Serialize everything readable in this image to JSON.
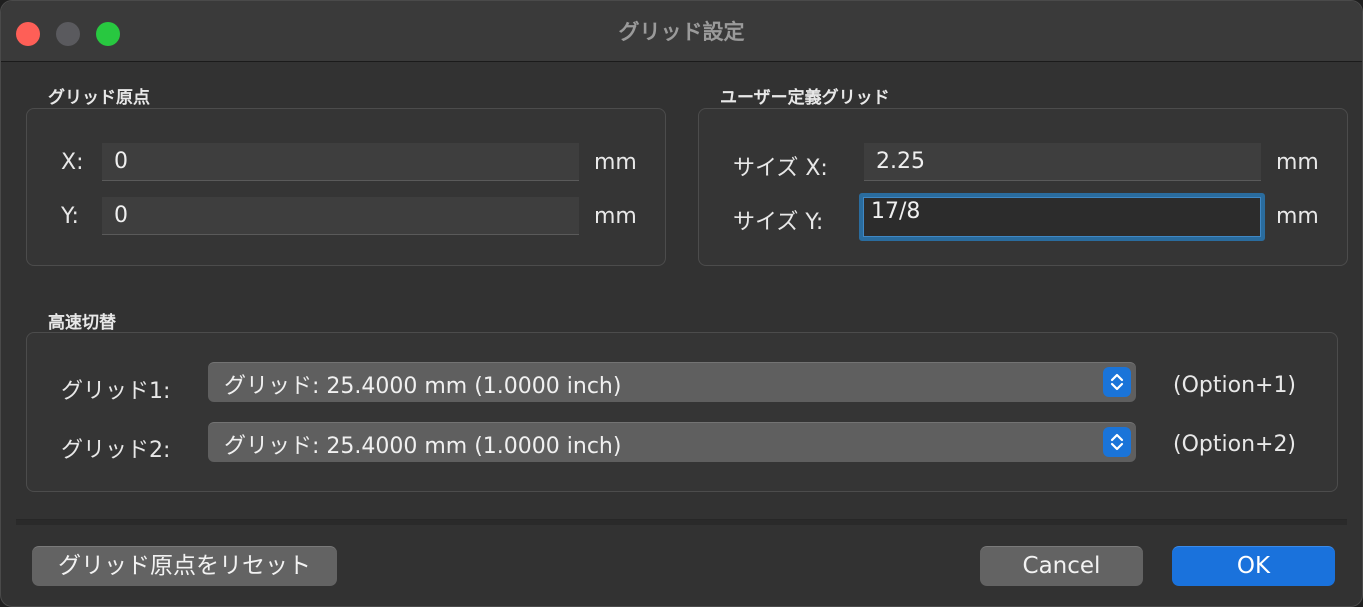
{
  "window": {
    "title": "グリッド設定"
  },
  "origin": {
    "label": "グリッド原点",
    "x_label": "X:",
    "x_value": "0",
    "x_unit": "mm",
    "y_label": "Y:",
    "y_value": "0",
    "y_unit": "mm"
  },
  "user_grid": {
    "label": "ユーザー定義グリッド",
    "x_label": "サイズ X:",
    "x_value": "2.25",
    "x_unit": "mm",
    "y_label": "サイズ Y:",
    "y_value": "17/8",
    "y_unit": "mm"
  },
  "fast_switch": {
    "label": "高速切替",
    "grid1_label": "グリッド1:",
    "grid1_value": "グリッド: 25.4000 mm (1.0000 inch)",
    "grid1_shortcut": "(Option+1)",
    "grid2_label": "グリッド2:",
    "grid2_value": "グリッド: 25.4000 mm (1.0000 inch)",
    "grid2_shortcut": "(Option+2)"
  },
  "buttons": {
    "reset": "グリッド原点をリセット",
    "cancel": "Cancel",
    "ok": "OK"
  },
  "colors": {
    "accent": "#1a72dc",
    "focus_ring": "#2a6c9e",
    "close": "#fe5f57",
    "zoom": "#28c840"
  }
}
